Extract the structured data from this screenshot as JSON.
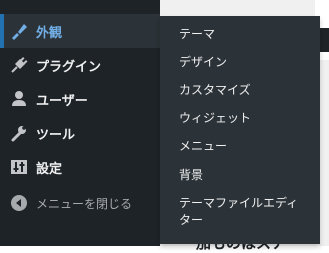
{
  "admin_menu": {
    "items": [
      {
        "label": "外観",
        "icon": "paintbrush-icon",
        "current": true
      },
      {
        "label": "プラグイン",
        "icon": "plugin-icon"
      },
      {
        "label": "ユーザー",
        "icon": "users-icon"
      },
      {
        "label": "ツール",
        "icon": "wrench-icon"
      },
      {
        "label": "設定",
        "icon": "settings-icon"
      }
    ],
    "collapse_label": "メニューを閉じる",
    "collapse_icon": "collapse-arrow-icon"
  },
  "submenu": {
    "items": [
      "テーマ",
      "デザイン",
      "カスタマイズ",
      "ウィジェット",
      "メニュー",
      "背景",
      "テーマファイルエディ",
      "ター"
    ]
  },
  "page_peek": {
    "text": "加ものはスナー"
  },
  "colors": {
    "menu_bg": "#1d2327",
    "submenu_bg": "#2c3338",
    "accent": "#72aee6",
    "current_marker": "#2271b1",
    "text": "#f0f0f1"
  }
}
